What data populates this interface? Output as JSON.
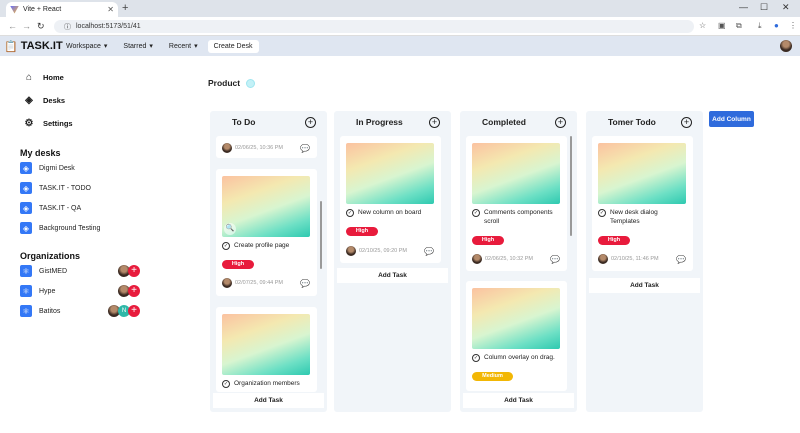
{
  "browser": {
    "tab_title": "Vite + React",
    "tab_close": "✕",
    "new_tab": "+",
    "url": "localhost:5173/51/41",
    "minimize": "—",
    "maximize": "☐",
    "window_close": "✕"
  },
  "app": {
    "logo": "TASK.IT",
    "nav": [
      {
        "label": "Workspace",
        "caret": "▾"
      },
      {
        "label": "Starred",
        "caret": "▾"
      },
      {
        "label": "Recent",
        "caret": "▾"
      },
      {
        "label": "Create Desk"
      }
    ]
  },
  "sidebar": {
    "links": [
      {
        "label": "Home",
        "icon": "⌂"
      },
      {
        "label": "Desks",
        "icon": "◈"
      },
      {
        "label": "Settings",
        "icon": "⚙"
      }
    ],
    "desks_title": "My desks",
    "desks": [
      "Digmi Desk",
      "TASK.IT - TODO",
      "TASK.IT - QA",
      "Background Testing"
    ],
    "orgs_title": "Organizations",
    "orgs": [
      {
        "name": "GistMED"
      },
      {
        "name": "Hype"
      },
      {
        "name": "Batitos",
        "initial": "N"
      }
    ]
  },
  "board": {
    "title": "Product",
    "add_column": "Add Column",
    "add_task": "Add Task",
    "columns": [
      {
        "title": "To Do",
        "cards": [
          {
            "date": "02/06/25, 10:36 PM"
          },
          {
            "title": "Create profile page",
            "priority": "High",
            "date": "02/07/25, 09:44 PM"
          },
          {
            "title": "Organization members"
          }
        ]
      },
      {
        "title": "In Progress",
        "cards": [
          {
            "title": "New column on board",
            "priority": "High",
            "date": "02/10/25, 09:20 PM"
          }
        ]
      },
      {
        "title": "Completed",
        "cards": [
          {
            "title": "Comments components scroll",
            "priority": "High",
            "date": "02/06/25, 10:32 PM"
          },
          {
            "title": "Column overlay on drag.",
            "priority": "Medium"
          }
        ]
      },
      {
        "title": "Tomer Todo",
        "cards": [
          {
            "title": "New desk dialog Templates",
            "priority": "High",
            "date": "02/10/25, 11:46 PM"
          }
        ]
      }
    ]
  },
  "colors": {
    "accent": "#2f6bdc",
    "high": "#e81b3c",
    "medium": "#f2b705",
    "header": "#dfe6f1"
  }
}
